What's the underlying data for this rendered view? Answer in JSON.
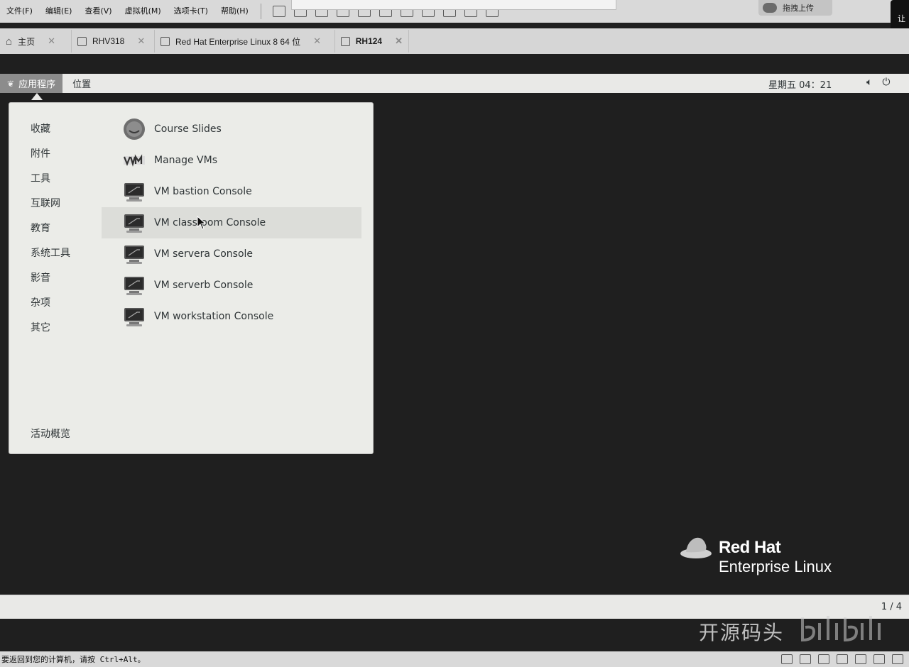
{
  "host": {
    "menu": [
      "文件(F)",
      "编辑(E)",
      "查看(V)",
      "虚拟机(M)",
      "选项卡(T)",
      "帮助(H)"
    ],
    "upload_label": "拖拽上传",
    "edge_label": "让",
    "tabs": [
      {
        "label": "主页",
        "icon": "home-icon"
      },
      {
        "label": "RHV318",
        "icon": "vm-icon"
      },
      {
        "label": "Red Hat Enterprise Linux 8 64 位",
        "icon": "vm-icon"
      },
      {
        "label": "RH124",
        "icon": "vm-running-icon",
        "active": true
      }
    ],
    "status_message": "要返回到您的计算机，请按 Ctrl+Alt。"
  },
  "gnome": {
    "topbar": {
      "applications": "应用程序",
      "places": "位置",
      "clock": "星期五 04：21"
    },
    "categories": [
      "收藏",
      "附件",
      "工具",
      "互联网",
      "教育",
      "系统工具",
      "影音",
      "杂项",
      "其它"
    ],
    "activities": "活动概览",
    "apps": [
      {
        "label": "Course Slides",
        "icon": "course-slides-icon"
      },
      {
        "label": "Manage VMs",
        "icon": "manage-vms-icon"
      },
      {
        "label": "VM bastion Console",
        "icon": "monitor-icon"
      },
      {
        "label": "VM classroom Console",
        "icon": "monitor-icon",
        "hovered": true
      },
      {
        "label": "VM servera Console",
        "icon": "monitor-icon"
      },
      {
        "label": "VM serverb Console",
        "icon": "monitor-icon"
      },
      {
        "label": "VM workstation Console",
        "icon": "monitor-icon"
      }
    ],
    "logo": {
      "line1": "Red Hat",
      "line2": "Enterprise Linux"
    },
    "workspace_indicator": "1 / 4"
  },
  "overlay": {
    "watermark": "开源码头"
  }
}
